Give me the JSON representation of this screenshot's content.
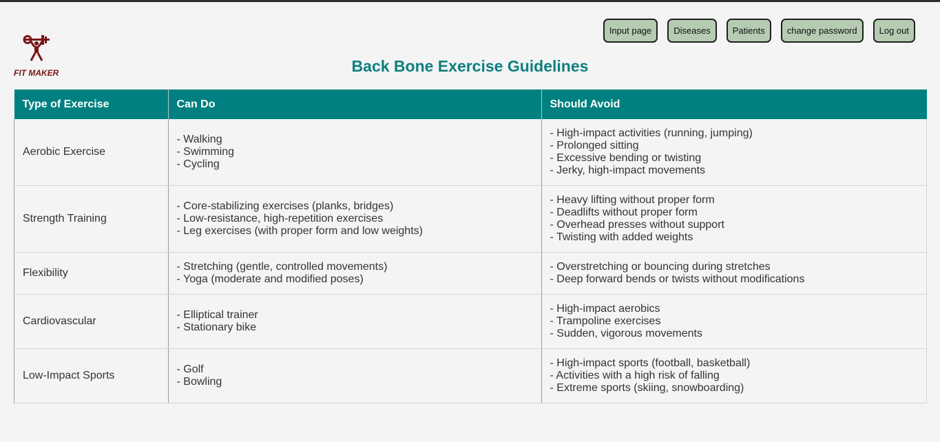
{
  "brand": {
    "logo_text": "FIT MAKER",
    "logo_color": "#7a1414"
  },
  "nav": [
    {
      "label": "Input page"
    },
    {
      "label": "Diseases"
    },
    {
      "label": "Patients"
    },
    {
      "label": "change password"
    },
    {
      "label": "Log out"
    }
  ],
  "page": {
    "title": "Back Bone Exercise Guidelines",
    "title_color": "#0f7f7f"
  },
  "table": {
    "header_color": "#008080",
    "columns": [
      "Type of Exercise",
      "Can Do",
      "Should Avoid"
    ],
    "rows": [
      {
        "type": "Aerobic Exercise",
        "can_do": [
          "- Walking",
          "- Swimming",
          "- Cycling"
        ],
        "avoid": [
          "- High-impact activities (running, jumping)",
          "- Prolonged sitting",
          "- Excessive bending or twisting",
          "- Jerky, high-impact movements"
        ]
      },
      {
        "type": "Strength Training",
        "can_do": [
          "- Core-stabilizing exercises (planks, bridges)",
          "- Low-resistance, high-repetition exercises",
          "- Leg exercises (with proper form and low weights)"
        ],
        "avoid": [
          "- Heavy lifting without proper form",
          "- Deadlifts without proper form",
          "- Overhead presses without support",
          "- Twisting with added weights"
        ]
      },
      {
        "type": "Flexibility",
        "can_do": [
          "- Stretching (gentle, controlled movements)",
          "- Yoga (moderate and modified poses)"
        ],
        "avoid": [
          "- Overstretching or bouncing during stretches",
          "- Deep forward bends or twists without modifications"
        ]
      },
      {
        "type": "Cardiovascular",
        "can_do": [
          "- Elliptical trainer",
          "- Stationary bike"
        ],
        "avoid": [
          "- High-impact aerobics",
          "- Trampoline exercises",
          "- Sudden, vigorous movements"
        ]
      },
      {
        "type": "Low-Impact Sports",
        "can_do": [
          "- Golf",
          "- Bowling"
        ],
        "avoid": [
          "- High-impact sports (football, basketball)",
          "- Activities with a high risk of falling",
          "- Extreme sports (skiing, snowboarding)"
        ]
      }
    ]
  }
}
